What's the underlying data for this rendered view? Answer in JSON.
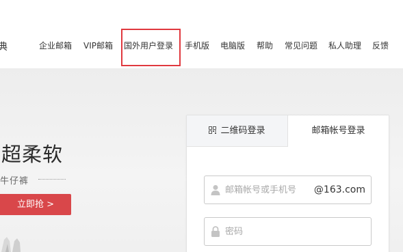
{
  "header": {
    "brand_fragment": "典",
    "nav": [
      {
        "label": "企业邮箱"
      },
      {
        "label": "VIP邮箱"
      },
      {
        "label": "国外用户登录",
        "highlighted": true
      },
      {
        "label": "手机版"
      },
      {
        "label": "电脑版"
      },
      {
        "label": "帮助"
      },
      {
        "label": "常见问题"
      },
      {
        "label": "私人助理"
      },
      {
        "label": "反馈"
      }
    ],
    "highlight_color": "#e0383e"
  },
  "promo": {
    "title": "超柔软",
    "subtitle": "牛仔裤",
    "button_label": "立即抢 >",
    "button_color": "#d9474a"
  },
  "login": {
    "tabs": [
      {
        "label": "二维码登录",
        "icon": "qr-code-icon"
      },
      {
        "label": "邮箱帐号登录",
        "active": true
      }
    ],
    "account_field": {
      "placeholder": "邮箱帐号或手机号",
      "value": "",
      "suffix": "@163.com",
      "icon": "user-icon"
    },
    "password_field": {
      "placeholder": "密码",
      "value": "",
      "icon": "lock-icon"
    }
  }
}
